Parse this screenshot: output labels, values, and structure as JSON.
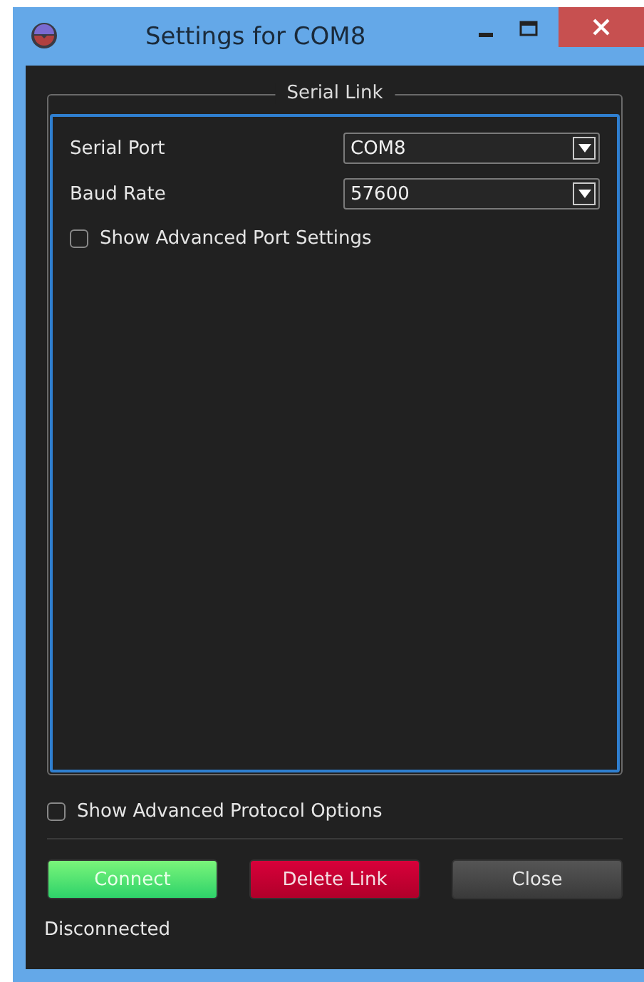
{
  "window": {
    "title": "Settings for COM8"
  },
  "group": {
    "title": "Serial Link",
    "fields": [
      {
        "label": "Serial Port",
        "value": "COM8"
      },
      {
        "label": "Baud Rate",
        "value": "57600"
      }
    ],
    "checkbox": {
      "label": "Show Advanced Port Settings",
      "checked": false
    }
  },
  "protocol_checkbox": {
    "label": "Show Advanced Protocol Options",
    "checked": false
  },
  "buttons": [
    {
      "label": "Connect",
      "kind": "connect"
    },
    {
      "label": "Delete Link",
      "kind": "delete"
    },
    {
      "label": "Close",
      "kind": "close"
    }
  ],
  "status": "Disconnected"
}
